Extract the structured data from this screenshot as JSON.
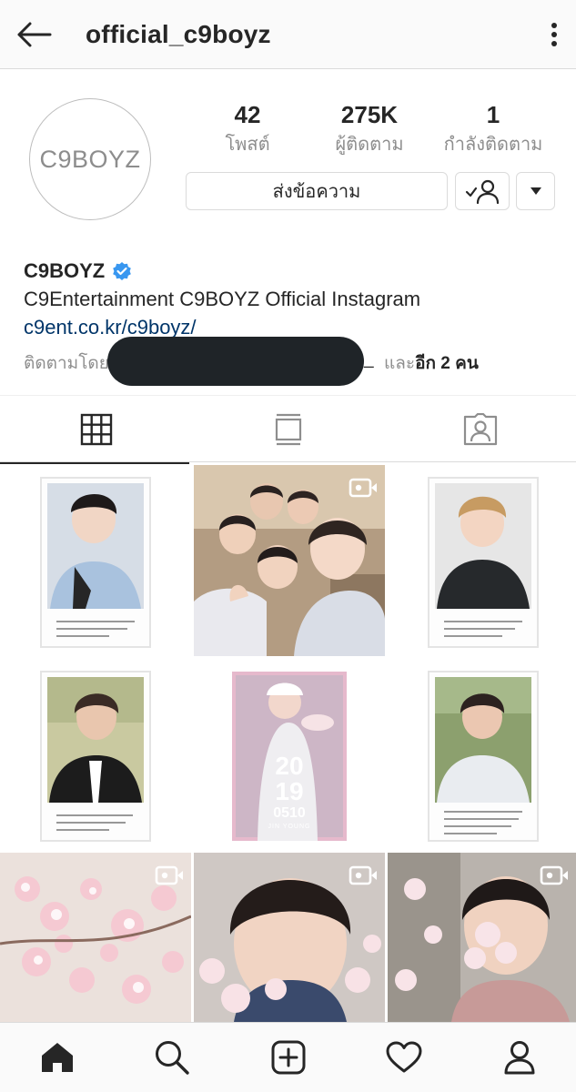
{
  "header": {
    "username": "official_c9boyz",
    "back_icon": "arrow-left-icon",
    "more_icon": "more-vertical-icon"
  },
  "profile": {
    "avatar_text": "C9BOYZ",
    "stats": [
      {
        "value": "42",
        "label": "โพสต์"
      },
      {
        "value": "275K",
        "label": "ผู้ติดตาม"
      },
      {
        "value": "1",
        "label": "กำลังติดตาม"
      }
    ],
    "message_button": "ส่งข้อความ",
    "following_icon": "user-check-icon",
    "dropdown_icon": "caret-down-icon",
    "display_name": "C9BOYZ",
    "verified_icon": "verified-badge-icon",
    "bio": "C9Entertainment C9BOYZ Official Instagram",
    "link": "c9ent.co.kr/c9boyz/",
    "followed_by_prefix": "ติดตามโดย",
    "followed_by_underscore": "_",
    "followed_by_and": "และ",
    "followed_by_others": "อีก 2 คน"
  },
  "tabs": [
    {
      "name": "grid",
      "icon": "grid-icon",
      "active": true
    },
    {
      "name": "feed",
      "icon": "feed-icon",
      "active": false
    },
    {
      "name": "tagged",
      "icon": "tagged-user-icon",
      "active": false
    }
  ],
  "posts": [
    {
      "kind": "polaroid-photo",
      "video": false,
      "caption_sign": "From. BX"
    },
    {
      "kind": "group-selfie",
      "video": true
    },
    {
      "kind": "polaroid-photo",
      "video": false,
      "caption_sign": "From. 승훈"
    },
    {
      "kind": "polaroid-photo",
      "video": false,
      "caption_sign": "From. 동현"
    },
    {
      "kind": "birthday-card",
      "video": false,
      "card_year_top": "20",
      "card_year_bottom": "19",
      "card_date": "0510",
      "card_name": "JIN YOUNG"
    },
    {
      "kind": "polaroid-photo",
      "video": false,
      "caption_sign": "From. 현석"
    },
    {
      "kind": "cherry-blossom",
      "video": true
    },
    {
      "kind": "portrait-blossom",
      "video": true
    },
    {
      "kind": "portrait-blossom",
      "video": true
    }
  ],
  "bottom_nav": [
    {
      "name": "home",
      "icon": "home-icon",
      "active": true
    },
    {
      "name": "search",
      "icon": "search-icon",
      "active": false
    },
    {
      "name": "new-post",
      "icon": "add-post-icon",
      "active": false
    },
    {
      "name": "activity",
      "icon": "heart-icon",
      "active": false
    },
    {
      "name": "profile",
      "icon": "profile-icon",
      "active": false
    }
  ],
  "colors": {
    "link": "#003569",
    "verified": "#3897f0",
    "muted": "#8e8e8e",
    "border": "#dbdbdb"
  }
}
